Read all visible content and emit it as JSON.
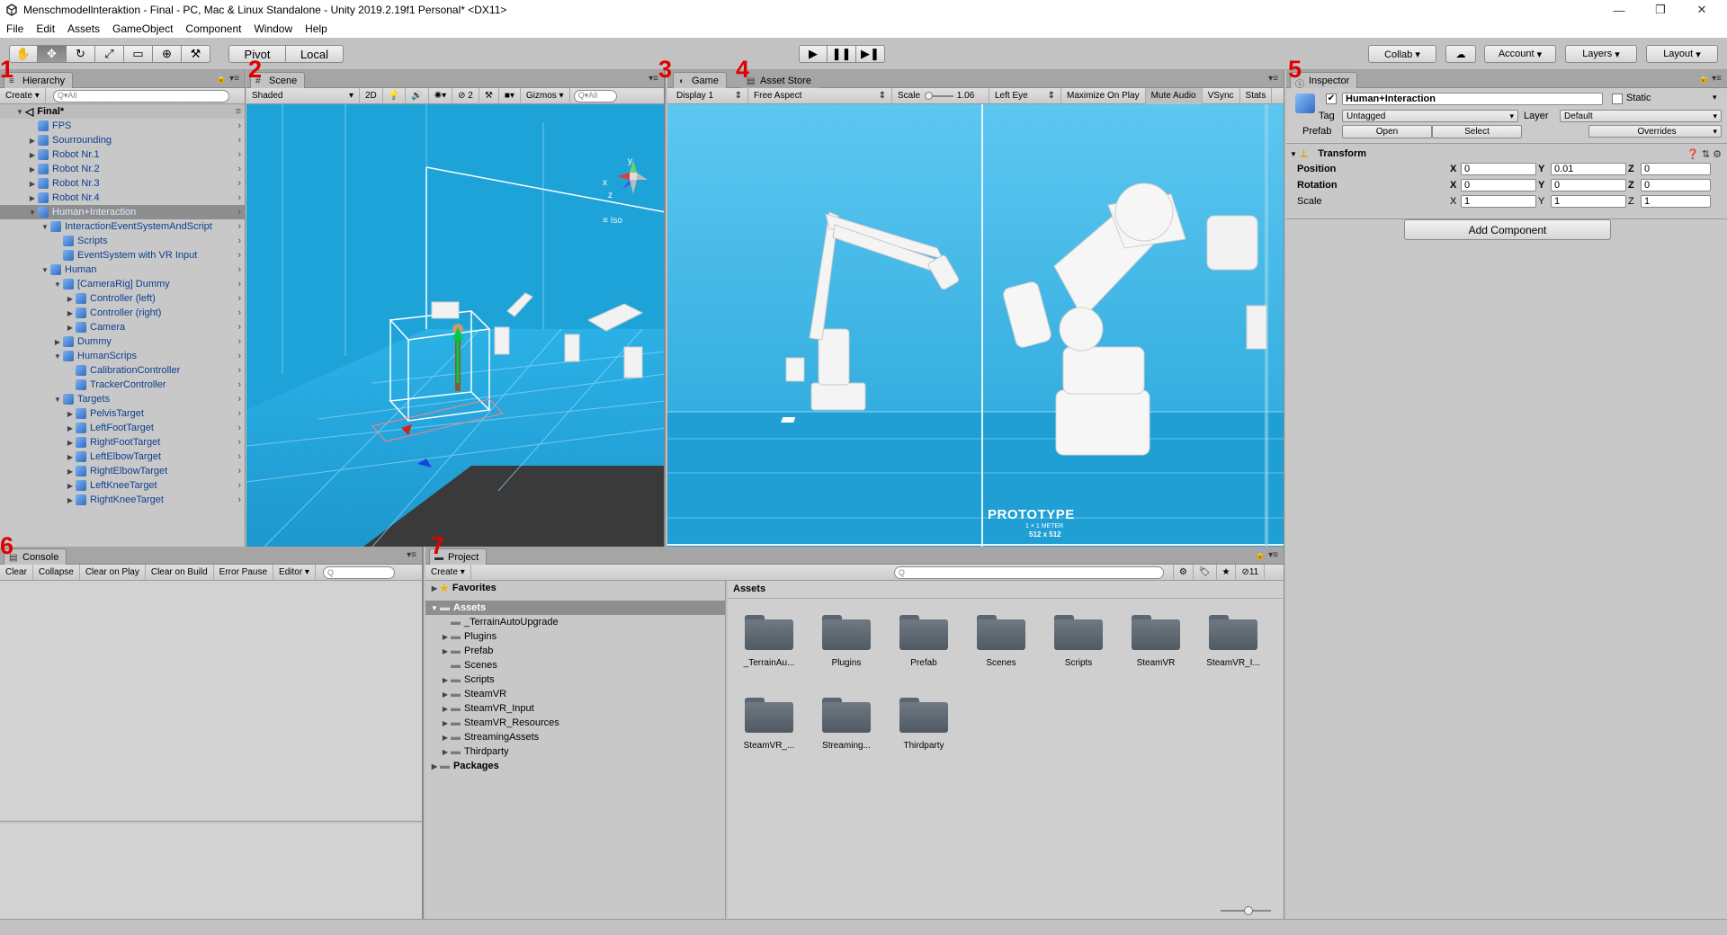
{
  "window": {
    "title": "Menschmodellnteraktion - Final - PC, Mac & Linux Standalone - Unity 2019.2.19f1 Personal* <DX11>",
    "minimize": "—",
    "maximize": "❐",
    "close": "✕"
  },
  "menu": [
    "File",
    "Edit",
    "Assets",
    "GameObject",
    "Component",
    "Window",
    "Help"
  ],
  "toolbar": {
    "tools": [
      "✋",
      "✥",
      "↻",
      "⤢",
      "▭",
      "⊕",
      "⚒"
    ],
    "pivot": "Pivot",
    "local": "Local",
    "play": "▶",
    "pause": "❚❚",
    "step": "▶❚",
    "collab": "Collab ▾",
    "cloud": "☁",
    "account": "Account",
    "layers": "Layers",
    "layout": "Layout"
  },
  "annotations": {
    "n1": "1",
    "n2": "2",
    "n3": "3",
    "n4": "4",
    "n5": "5",
    "n6": "6",
    "n7": "7"
  },
  "hierarchy": {
    "tab": "Hierarchy",
    "create": "Create",
    "search_placeholder": "Q▾All",
    "scene": "Final*",
    "items": [
      {
        "label": "FPS",
        "indent": 0,
        "arrow": "",
        "sel": false
      },
      {
        "label": "Sourrounding",
        "indent": 0,
        "arrow": "▶",
        "sel": false
      },
      {
        "label": "Robot Nr.1",
        "indent": 0,
        "arrow": "▶",
        "sel": false
      },
      {
        "label": "Robot Nr.2",
        "indent": 0,
        "arrow": "▶",
        "sel": false
      },
      {
        "label": "Robot Nr.3",
        "indent": 0,
        "arrow": "▶",
        "sel": false
      },
      {
        "label": "Robot Nr.4",
        "indent": 0,
        "arrow": "▶",
        "sel": false
      },
      {
        "label": "Human+Interaction",
        "indent": 0,
        "arrow": "▼",
        "sel": true
      },
      {
        "label": "InteractionEventSystemAndScript",
        "indent": 1,
        "arrow": "▼",
        "sel": false
      },
      {
        "label": "Scripts",
        "indent": 2,
        "arrow": "",
        "sel": false
      },
      {
        "label": "EventSystem with VR Input",
        "indent": 2,
        "arrow": "",
        "sel": false
      },
      {
        "label": "Human",
        "indent": 1,
        "arrow": "▼",
        "sel": false
      },
      {
        "label": "[CameraRig] Dummy",
        "indent": 2,
        "arrow": "▼",
        "sel": false
      },
      {
        "label": "Controller (left)",
        "indent": 3,
        "arrow": "▶",
        "sel": false
      },
      {
        "label": "Controller (right)",
        "indent": 3,
        "arrow": "▶",
        "sel": false
      },
      {
        "label": "Camera",
        "indent": 3,
        "arrow": "▶",
        "sel": false
      },
      {
        "label": "Dummy",
        "indent": 2,
        "arrow": "▶",
        "sel": false
      },
      {
        "label": "HumanScrips",
        "indent": 2,
        "arrow": "▼",
        "sel": false
      },
      {
        "label": "CalibrationController",
        "indent": 3,
        "arrow": "",
        "sel": false
      },
      {
        "label": "TrackerController",
        "indent": 3,
        "arrow": "",
        "sel": false
      },
      {
        "label": "Targets",
        "indent": 2,
        "arrow": "▼",
        "sel": false
      },
      {
        "label": "PelvisTarget",
        "indent": 3,
        "arrow": "▶",
        "sel": false
      },
      {
        "label": "LeftFootTarget",
        "indent": 3,
        "arrow": "▶",
        "sel": false
      },
      {
        "label": "RightFootTarget",
        "indent": 3,
        "arrow": "▶",
        "sel": false
      },
      {
        "label": "LeftElbowTarget",
        "indent": 3,
        "arrow": "▶",
        "sel": false
      },
      {
        "label": "RightElbowTarget",
        "indent": 3,
        "arrow": "▶",
        "sel": false
      },
      {
        "label": "LeftKneeTarget",
        "indent": 3,
        "arrow": "▶",
        "sel": false
      },
      {
        "label": "RightKneeTarget",
        "indent": 3,
        "arrow": "▶",
        "sel": false
      }
    ]
  },
  "scene": {
    "tab": "Scene",
    "shading": "Shaded",
    "mode2d": "2D",
    "hidden_count": "2",
    "gizmos": "Gizmos",
    "search": "Q▾All",
    "iso": "≡ Iso",
    "axis_x": "x",
    "axis_y": "y",
    "axis_z": "z"
  },
  "game": {
    "tab": "Game",
    "asset_store_tab": "Asset Store",
    "display": "Display 1",
    "aspect": "Free Aspect",
    "scale_label": "Scale",
    "scale_value": "1.06",
    "eye": "Left Eye",
    "maximize": "Maximize On Play",
    "mute": "Mute Audio",
    "vsync": "VSync",
    "stats": "Stats",
    "prototype": "PROTOTYPE",
    "prototype_sub1": "1 × 1 METER",
    "prototype_sub2": "512 x 512"
  },
  "inspector": {
    "tab": "Inspector",
    "name": "Human+Interaction",
    "static": "Static",
    "tag_label": "Tag",
    "tag": "Untagged",
    "layer_label": "Layer",
    "layer": "Default",
    "prefab_label": "Prefab",
    "open": "Open",
    "select": "Select",
    "overrides": "Overrides",
    "transform": "Transform",
    "position": "Position",
    "rotation": "Rotation",
    "scale": "Scale",
    "pos": {
      "x": "0",
      "y": "0.01",
      "z": "0"
    },
    "rot": {
      "x": "0",
      "y": "0",
      "z": "0"
    },
    "scl": {
      "x": "1",
      "y": "1",
      "z": "1"
    },
    "x": "X",
    "y": "Y",
    "z": "Z",
    "add_component": "Add Component"
  },
  "console": {
    "tab": "Console",
    "buttons": [
      "Clear",
      "Collapse",
      "Clear on Play",
      "Clear on Build",
      "Error Pause",
      "Editor ▾"
    ]
  },
  "project": {
    "tab": "Project",
    "create": "Create",
    "hidden_count": "11",
    "favorites": "Favorites",
    "assets": "Assets",
    "packages": "Packages",
    "tree": [
      {
        "label": "_TerrainAutoUpgrade",
        "arrow": ""
      },
      {
        "label": "Plugins",
        "arrow": "▶"
      },
      {
        "label": "Prefab",
        "arrow": "▶"
      },
      {
        "label": "Scenes",
        "arrow": ""
      },
      {
        "label": "Scripts",
        "arrow": "▶"
      },
      {
        "label": "SteamVR",
        "arrow": "▶"
      },
      {
        "label": "SteamVR_Input",
        "arrow": "▶"
      },
      {
        "label": "SteamVR_Resources",
        "arrow": "▶"
      },
      {
        "label": "StreamingAssets",
        "arrow": "▶"
      },
      {
        "label": "Thirdparty",
        "arrow": "▶"
      }
    ],
    "breadcrumb": "Assets",
    "folders": [
      "_TerrainAu...",
      "Plugins",
      "Prefab",
      "Scenes",
      "Scripts",
      "SteamVR",
      "SteamVR_I...",
      "SteamVR_...",
      "Streaming...",
      "Thirdparty"
    ]
  }
}
